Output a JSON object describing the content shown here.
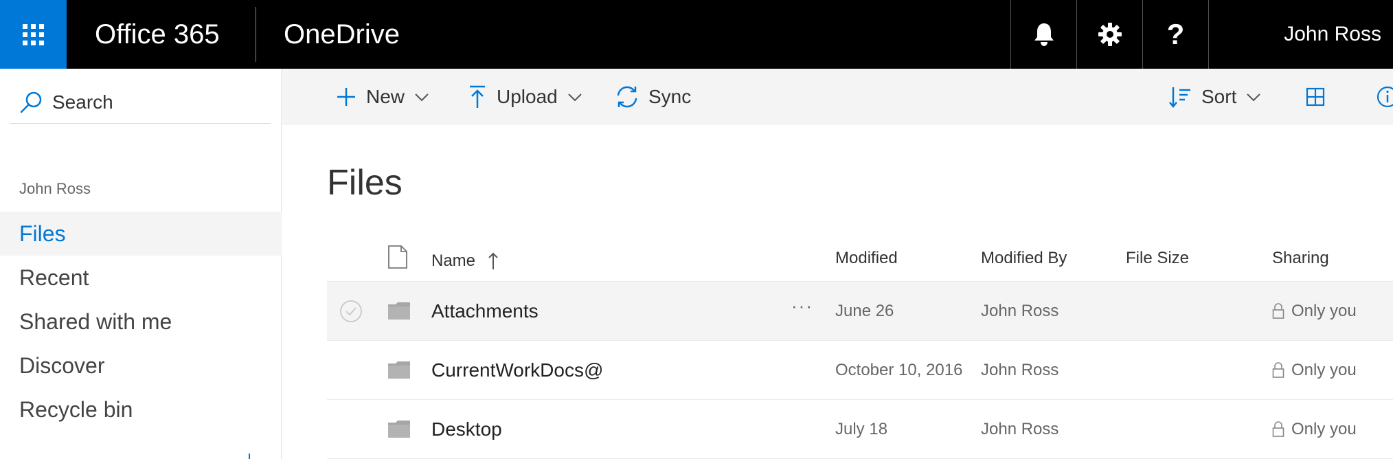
{
  "topbar": {
    "app_title": "Office 365",
    "product_title": "OneDrive",
    "help_glyph": "?",
    "user_name": "John Ross",
    "icons": [
      "waffle-icon",
      "bell-icon",
      "gear-icon",
      "help-icon"
    ]
  },
  "leftnav": {
    "search_placeholder": "Search",
    "owner": "John Ross",
    "items": [
      {
        "label": "Files",
        "active": true
      },
      {
        "label": "Recent",
        "active": false
      },
      {
        "label": "Shared with me",
        "active": false
      },
      {
        "label": "Discover",
        "active": false
      },
      {
        "label": "Recycle bin",
        "active": false
      }
    ]
  },
  "commandbar": {
    "new_label": "New",
    "upload_label": "Upload",
    "sync_label": "Sync",
    "sort_label": "Sort"
  },
  "main": {
    "title": "Files",
    "columns": {
      "name": "Name",
      "modified": "Modified",
      "modified_by": "Modified By",
      "file_size": "File Size",
      "sharing": "Sharing"
    },
    "rows": [
      {
        "name": "Attachments",
        "modified": "June 26",
        "modified_by": "John Ross",
        "file_size": "",
        "sharing": "Only you",
        "more": "···"
      },
      {
        "name": "CurrentWorkDocs@",
        "modified": "October 10, 2016",
        "modified_by": "John Ross",
        "file_size": "",
        "sharing": "Only you"
      },
      {
        "name": "Desktop",
        "modified": "July 18",
        "modified_by": "John Ross",
        "file_size": "",
        "sharing": "Only you"
      }
    ]
  },
  "colors": {
    "accent": "#0078d7",
    "topbar_bg": "#000000",
    "commandbar_bg": "#f4f4f4",
    "selected_row_bg": "#f4f4f4",
    "folder_gray": "#a6a6a6"
  }
}
